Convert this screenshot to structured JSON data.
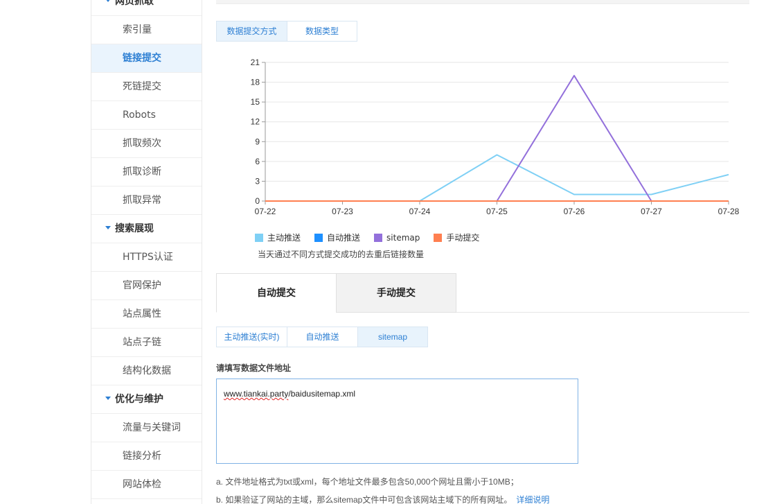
{
  "sidebar": {
    "group1": "网页抓取",
    "group1_items": [
      "索引量",
      "链接提交",
      "死链提交",
      "Robots",
      "抓取频次",
      "抓取诊断",
      "抓取异常"
    ],
    "group2": "搜索展现",
    "group2_items": [
      "HTTPS认证",
      "官网保护",
      "站点属性",
      "站点子链",
      "结构化数据"
    ],
    "group3": "优化与维护",
    "group3_items": [
      "流量与关键词",
      "链接分析",
      "网站体检"
    ],
    "active": "链接提交"
  },
  "chart_tabs": [
    "数据提交方式",
    "数据类型"
  ],
  "chart_tabs_active": "数据提交方式",
  "chart_data": {
    "type": "line",
    "categories": [
      "07-22",
      "07-23",
      "07-24",
      "07-25",
      "07-26",
      "07-27",
      "07-28"
    ],
    "y_ticks": [
      "0",
      "3",
      "6",
      "9",
      "12",
      "15",
      "18",
      "21"
    ],
    "ylim": [
      0,
      21
    ],
    "grid": true,
    "legend_position": "bottom-left",
    "series": [
      {
        "name": "主动推送",
        "color": "#7fd0f5",
        "values": [
          0,
          0,
          0,
          7,
          1,
          1,
          4
        ]
      },
      {
        "name": "自动推送",
        "color": "#1e90ff",
        "values": [
          0,
          0,
          0,
          0,
          0,
          0,
          0
        ]
      },
      {
        "name": "sitemap",
        "color": "#9370db",
        "values": [
          0,
          0,
          0,
          0,
          19,
          0,
          0
        ]
      },
      {
        "name": "手动提交",
        "color": "#ff7f50",
        "values": [
          0,
          0,
          0,
          0,
          0,
          0,
          0
        ]
      }
    ],
    "caption": "当天通过不同方式提交成功的去重后链接数量"
  },
  "big_tabs": [
    "自动提交",
    "手动提交"
  ],
  "big_tabs_active": "自动提交",
  "sub_tabs": [
    "主动推送(实时)",
    "自动推送",
    "sitemap"
  ],
  "sub_tabs_active": "sitemap",
  "form": {
    "label": "请填写数据文件地址",
    "value_part1": "www.tiankai.party",
    "value_part2": "/baidusitemap.xml"
  },
  "notes": {
    "a": "a. 文件地址格式为txt或xml，每个地址文件最多包含50,000个网址且需小于10MB；",
    "b": "b. 如果验证了网站的主域，那么sitemap文件中可包含该网站主域下的所有网址。",
    "b_link": "详细说明"
  }
}
